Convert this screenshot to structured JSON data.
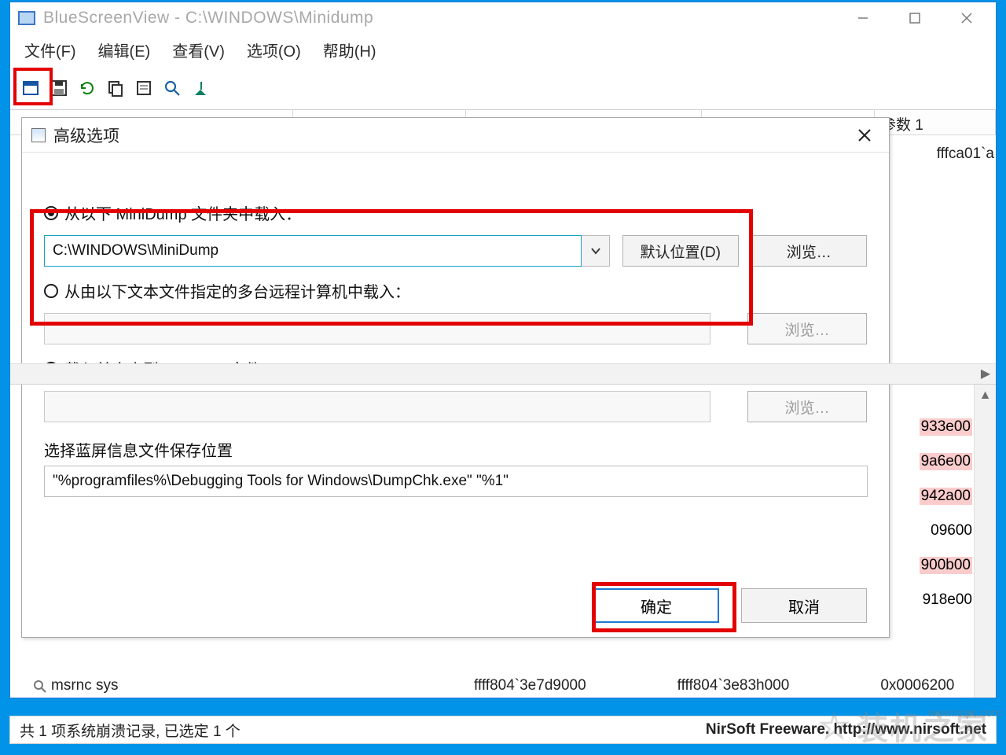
{
  "window": {
    "title": "BlueScreenView  -  C:\\WINDOWS\\Minidump",
    "menu": [
      "文件(F)",
      "编辑(E)",
      "查看(V)",
      "选项(O)",
      "帮助(H)"
    ],
    "header_partial_right": "参数 1",
    "header_value_fragment": "fffca01`a"
  },
  "dialog": {
    "title": "高级选项",
    "opt1": "从以下 MiniDump 文件夹中载入：",
    "opt1_value": "C:\\WINDOWS\\MiniDump",
    "default_btn": "默认位置(D)",
    "browse_btn": "浏览…",
    "opt2": "从由以下文本文件指定的多台远程计算机中载入：",
    "opt3": "载入单个小型MiniDump文件：",
    "save_label": "选择蓝屏信息文件保存位置",
    "save_value": "\"%programfiles%\\Debugging Tools for Windows\\DumpChk.exe\" \"%1\"",
    "ok": "确定",
    "cancel": "取消"
  },
  "lower": {
    "fragment_rows": [
      "933e00",
      "9a6e00",
      "942a00",
      "09600",
      "900b00",
      "918e00"
    ],
    "pink_rows_idx": [
      0,
      1,
      2,
      4
    ],
    "filename": "msrnc sys",
    "addr1": "ffff804`3e7d9000",
    "addr2": "ffff804`3e83h000",
    "addr3": "0x0006200"
  },
  "status": {
    "left": "共 1 项系统崩溃记录, 已选定 1 个",
    "right_plain": "NirSoft Freeware.  ",
    "right_link": "http://www.nirsoft.net"
  },
  "watermark": {
    "text": "装机之家",
    "small": "www.lotpc.com"
  }
}
